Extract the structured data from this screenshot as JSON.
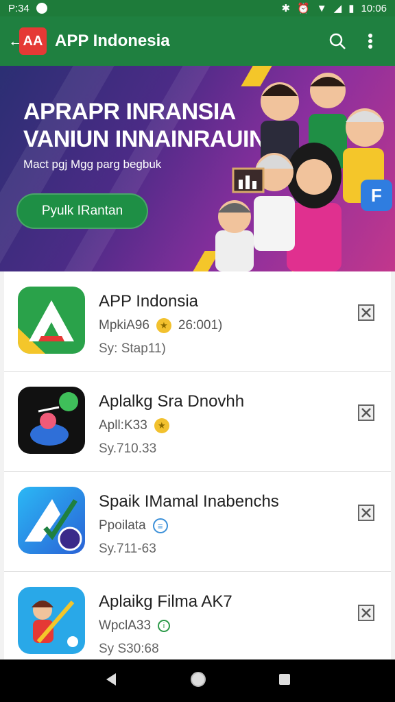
{
  "status": {
    "time_left": "P:34",
    "time_right": "10:06"
  },
  "appbar": {
    "logo_text": "AA",
    "title": "APP Indonesia"
  },
  "banner": {
    "headline_1": "APRAPR INRANSIA",
    "headline_2": "VANIUN INNAINRAUIN",
    "subtitle": "Mact pgj Mgg parg begbuk",
    "button_label": "Pyulk IRantan"
  },
  "apps": [
    {
      "name": "APP Indonsia",
      "meta": "MpkiA96",
      "rating": "26:001)",
      "size": "Sy: Stap11)"
    },
    {
      "name": "Aplalkg Sra Dnovhh",
      "meta": "Apll:K33",
      "rating": "",
      "size": "Sy.710.33"
    },
    {
      "name": "Spaik IMamal Inabenchs",
      "meta": "Ppoilata",
      "rating": "",
      "size": "Sy.711-63"
    },
    {
      "name": "Aplaikg Filma AK7",
      "meta": "WpclA33",
      "rating": "",
      "size": "Sy S30:68"
    }
  ],
  "colors": {
    "primary": "#1f8040",
    "status": "#1e7b3a",
    "accent_red": "#e53935",
    "star": "#f2c12e"
  },
  "icons": [
    "back-arrow-icon",
    "search-icon",
    "more-vert-icon",
    "close-icon",
    "nav-back-icon",
    "nav-home-icon",
    "nav-recents-icon"
  ]
}
